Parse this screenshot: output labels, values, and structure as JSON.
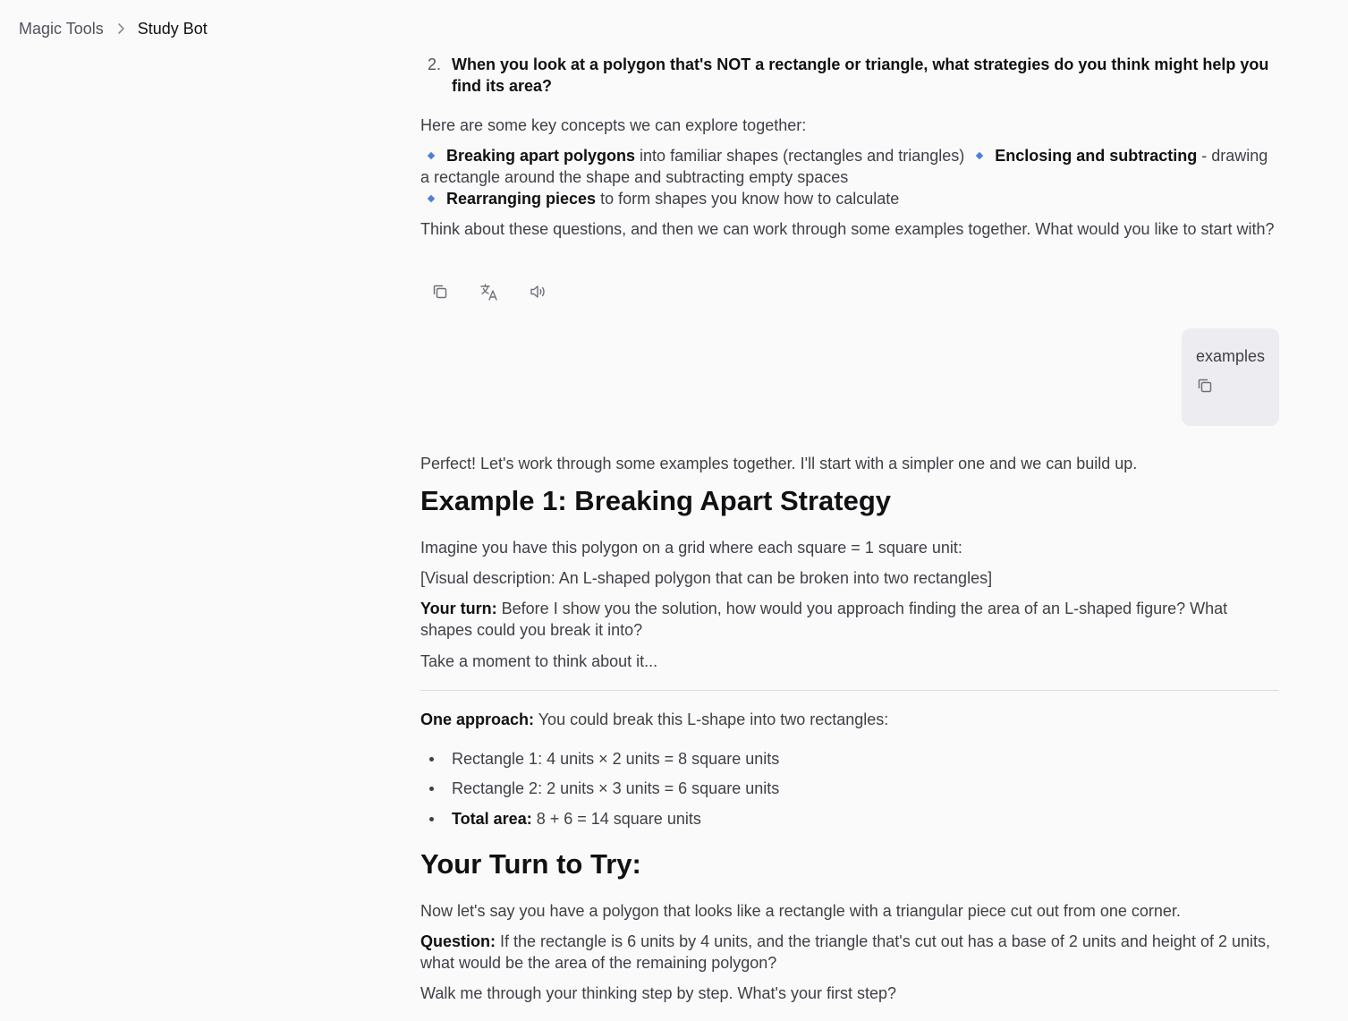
{
  "breadcrumb": {
    "parent": "Magic Tools",
    "current": "Study Bot"
  },
  "bot_message_1": {
    "question_number": "2.",
    "question_text": "When you look at a polygon that's NOT a rectangle or triangle, what strategies do you think might help you find its area?",
    "intro": "Here are some key concepts we can explore together:",
    "concepts": [
      {
        "bold": "Breaking apart polygons",
        "rest": " into familiar shapes (rectangles and triangles)"
      },
      {
        "bold": "Enclosing and subtracting",
        "rest": " - drawing a rectangle around the shape and subtracting empty spaces"
      },
      {
        "bold": "Rearranging pieces",
        "rest": " to form shapes you know how to calculate"
      }
    ],
    "closing": "Think about these questions, and then we can work through some examples together. What would you like to start with?",
    "actions": {
      "copy_icon": "copy-icon",
      "translate_icon": "translate-icon",
      "speaker_icon": "speaker-icon"
    }
  },
  "user_message": {
    "text": "examples",
    "copy_icon": "copy-icon"
  },
  "bot_message_2": {
    "intro": "Perfect! Let's work through some examples together. I'll start with a simpler one and we can build up.",
    "heading1": "Example 1: Breaking Apart Strategy",
    "p1": "Imagine you have this polygon on a grid where each square = 1 square unit:",
    "p2": "[Visual description: An L-shaped polygon that can be broken into two rectangles]",
    "your_turn_label": "Your turn:",
    "your_turn_text": " Before I show you the solution, how would you approach finding the area of an L-shaped figure? What shapes could you break it into?",
    "p3": "Take a moment to think about it...",
    "approach_label": "One approach:",
    "approach_text": " You could break this L-shape into two rectangles:",
    "bullets": [
      {
        "bold": "",
        "text": "Rectangle 1: 4 units × 2 units = 8 square units"
      },
      {
        "bold": "",
        "text": "Rectangle 2: 2 units × 3 units = 6 square units"
      },
      {
        "bold": "Total area:",
        "text": " 8 + 6 = 14 square units"
      }
    ],
    "heading2": "Your Turn to Try:",
    "p4": "Now let's say you have a polygon that looks like a rectangle with a triangular piece cut out from one corner.",
    "question_label": "Question:",
    "question_text": " If the rectangle is 6 units by 4 units, and the triangle that's cut out has a base of 2 units and height of 2 units, what would be the area of the remaining polygon?",
    "p5": "Walk me through your thinking step by step. What's your first step?"
  },
  "colors": {
    "background": "#fafafb",
    "bubble": "#ececf1",
    "diamond_bullet": "#4f7ed8",
    "text": "#3f3f46",
    "strong": "#111113"
  }
}
